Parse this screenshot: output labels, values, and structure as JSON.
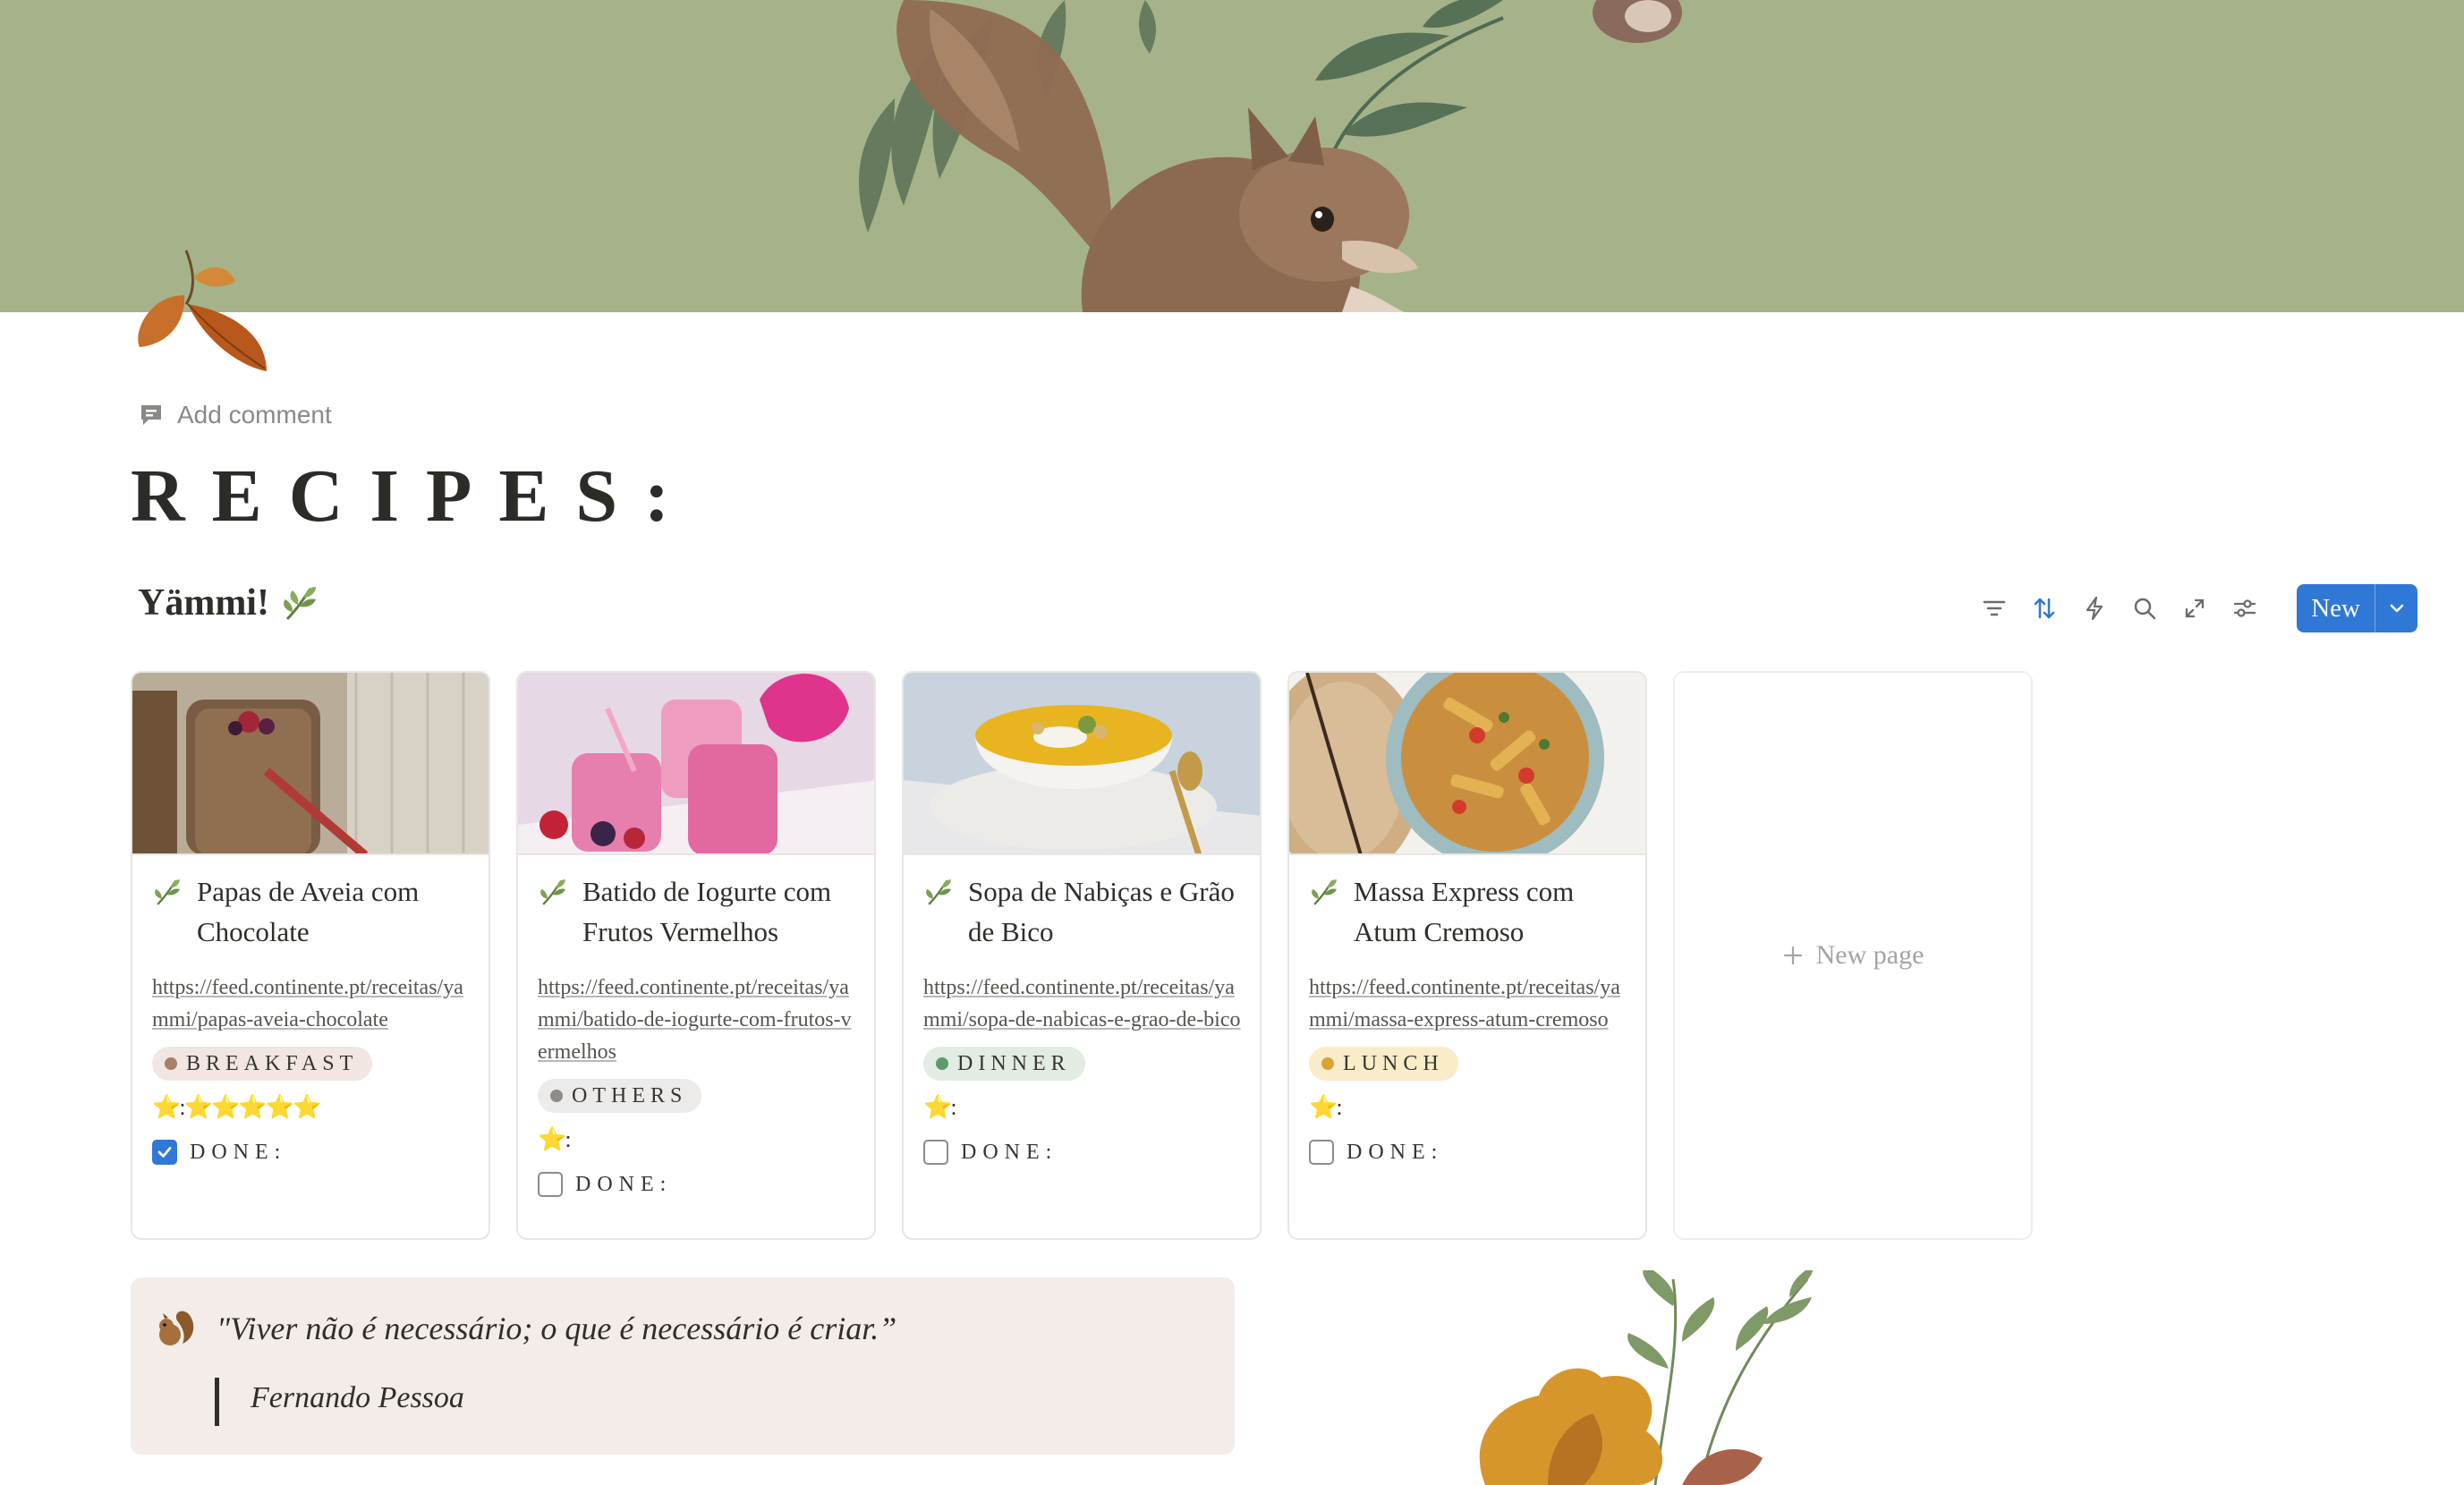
{
  "page": {
    "add_comment": "Add comment",
    "title": "RECIPES:",
    "database_title": "Yämmi!",
    "database_icon": "herb-emoji"
  },
  "toolbar": {
    "icons": [
      "filter-icon",
      "sort-icon",
      "automation-icon",
      "search-icon",
      "expand-icon",
      "settings-icon"
    ],
    "new_label": "New",
    "accent": "#2f78d6"
  },
  "cards": [
    {
      "title": "Papas de Aveia com Chocolate",
      "url": "https://feed.continente.pt/receitas/yammi/papas-aveia-chocolate",
      "category": "BREAKFAST",
      "category_bg": "#f1e6e1",
      "category_dot": "#a97e6c",
      "rating": "⭐️:⭐️⭐️⭐️⭐️⭐️",
      "done_label": "DONE:",
      "done": true
    },
    {
      "title": "Batido de Iogurte com Frutos Vermelhos",
      "url": "https://feed.continente.pt/receitas/yammi/batido-de-iogurte-com-frutos-vermelhos",
      "category": "OTHERS",
      "category_bg": "#ecebe9",
      "category_dot": "#8d8c88",
      "rating": "⭐️:",
      "done_label": "DONE:",
      "done": false
    },
    {
      "title": "Sopa de Nabiças e Grão de Bico",
      "url": "https://feed.continente.pt/receitas/yammi/sopa-de-nabicas-e-grao-de-bico",
      "category": "DINNER",
      "category_bg": "#e2ece3",
      "category_dot": "#5e9b6c",
      "rating": "⭐️:",
      "done_label": "DONE:",
      "done": false
    },
    {
      "title": "Massa Express com Atum Cremoso",
      "url": "https://feed.continente.pt/receitas/yammi/massa-express-atum-cremoso",
      "category": "LUNCH",
      "category_bg": "#f8ecc9",
      "category_dot": "#d6a633",
      "rating": "⭐️:",
      "done_label": "DONE:",
      "done": false
    }
  ],
  "new_page_label": "New page",
  "quote": {
    "icon": "squirrel-emoji",
    "text": "\"Viver não é necessário; o que é necessário é criar.”",
    "author": "Fernando Pessoa"
  },
  "colors": {
    "cover": "#a6b38a",
    "quote_bg": "#f3ece9"
  }
}
